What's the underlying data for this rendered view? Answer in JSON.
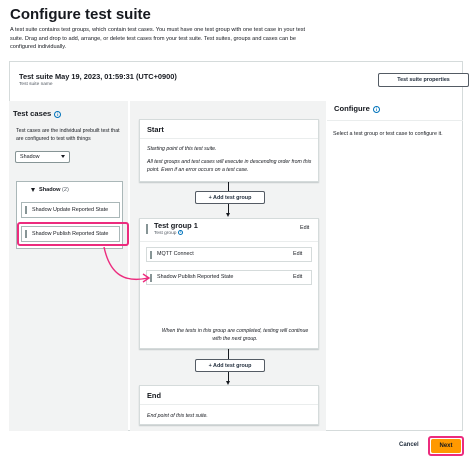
{
  "page": {
    "title": "Configure test suite",
    "description": "A test suite contains test groups, which contain test cases. You must have one test group with one test case in your test suite. Drag and drop to add, arrange, or delete test cases from your test suite. Test suites, groups and cases can be configured individually."
  },
  "suite": {
    "title": "Test suite May 19, 2023, 01:59:31 (UTC+0900)",
    "subtitle": "Test suite name",
    "properties_button": "Test suite properties"
  },
  "test_cases": {
    "heading": "Test cases",
    "info": "i",
    "description": "Test cases are the individual prebuilt test that are configured to test with things",
    "filter_value": "Shadow",
    "group": {
      "label": "Shadow",
      "count": "(2)",
      "items": [
        {
          "label": "Shadow Update Reported State"
        },
        {
          "label": "Shadow Publish Reported State"
        }
      ]
    }
  },
  "configure": {
    "heading": "Configure",
    "info": "i",
    "hint": "Select a test group or test case to configure it."
  },
  "flow": {
    "start": {
      "title": "Start",
      "text1": "Starting point of this test suite.",
      "text2": "All test groups and test cases will execute in descending order from this point. Even if an error occurs on a test case."
    },
    "add_group_label": "+ Add test group",
    "test_group": {
      "title": "Test group 1",
      "subtitle": "Test group",
      "info": "i",
      "edit": "Edit",
      "items": [
        {
          "label": "MQTT Connect",
          "edit": "Edit"
        },
        {
          "label": "Shadow Publish Reported State",
          "edit": "Edit"
        }
      ],
      "footer_text": "When the tests in this group are completed, testing will continue with the next group."
    },
    "end": {
      "title": "End",
      "text": "End point of this test suite."
    }
  },
  "footer": {
    "cancel": "Cancel",
    "next": "Next"
  },
  "colors": {
    "accent": "#ff9900",
    "highlight": "#ec2c7e",
    "link": "#0073bb"
  }
}
